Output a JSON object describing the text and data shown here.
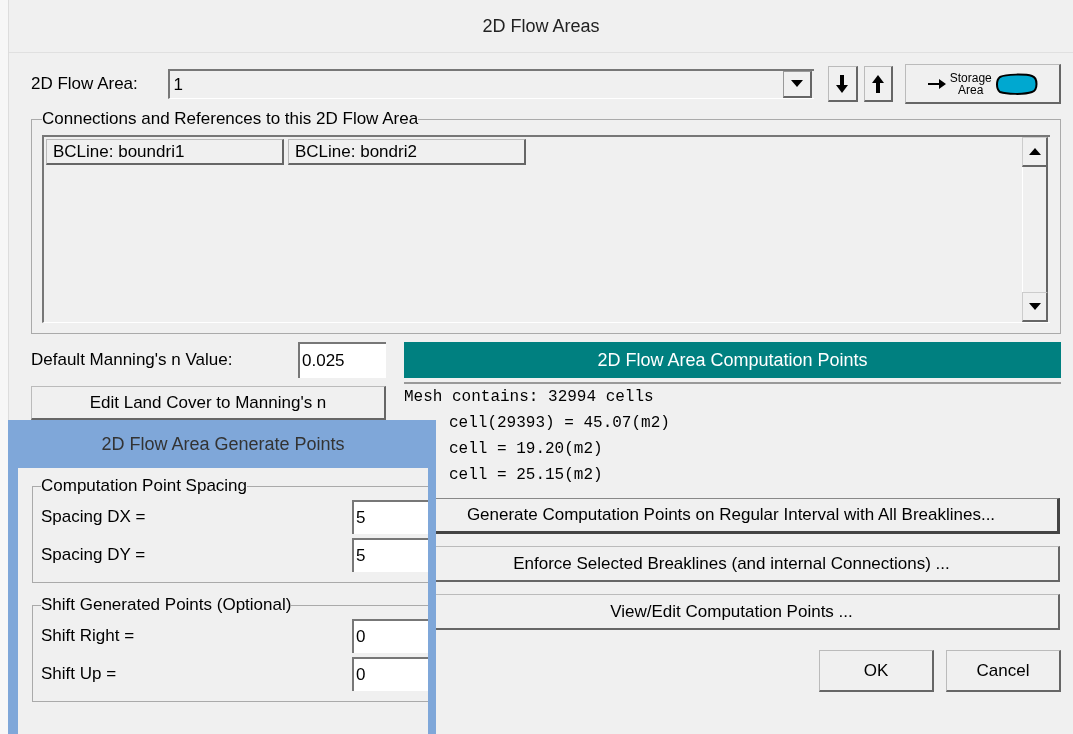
{
  "window": {
    "title": "2D Flow Areas"
  },
  "flow_area": {
    "label": "2D Flow Area:",
    "value": "1"
  },
  "storage_button": {
    "line1": "Storage",
    "line2": "Area"
  },
  "connections": {
    "legend": "Connections and References to this 2D Flow Area",
    "items": [
      "BCLine: boundri1",
      "BCLine: bondri2"
    ]
  },
  "manning": {
    "label": "Default Manning's n Value:",
    "value": "0.025",
    "edit_button": "Edit Land Cover to Manning's n"
  },
  "computation": {
    "header": "2D Flow Area Computation Points",
    "mesh_lines": [
      "Mesh contains: 32994 cells",
      "cell(29393) = 45.07(m2)",
      "cell = 19.20(m2)",
      "cell = 25.15(m2)"
    ],
    "buttons": [
      "Generate Computation Points on Regular Interval with All Breaklines...",
      "Enforce Selected Breaklines (and internal Connections) ...",
      "View/Edit Computation Points ..."
    ]
  },
  "dialog_buttons": [
    "OK",
    "Cancel"
  ],
  "generate_dialog": {
    "title": "2D Flow Area Generate Points",
    "groups": [
      {
        "legend": "Computation Point Spacing",
        "fields": [
          {
            "label": "Spacing DX =",
            "value": "5"
          },
          {
            "label": "Spacing DY =",
            "value": "5"
          }
        ]
      },
      {
        "legend": "Shift Generated Points (Optional)",
        "fields": [
          {
            "label": "Shift Right =",
            "value": "0"
          },
          {
            "label": "Shift Up =",
            "value": "0"
          }
        ]
      }
    ]
  }
}
